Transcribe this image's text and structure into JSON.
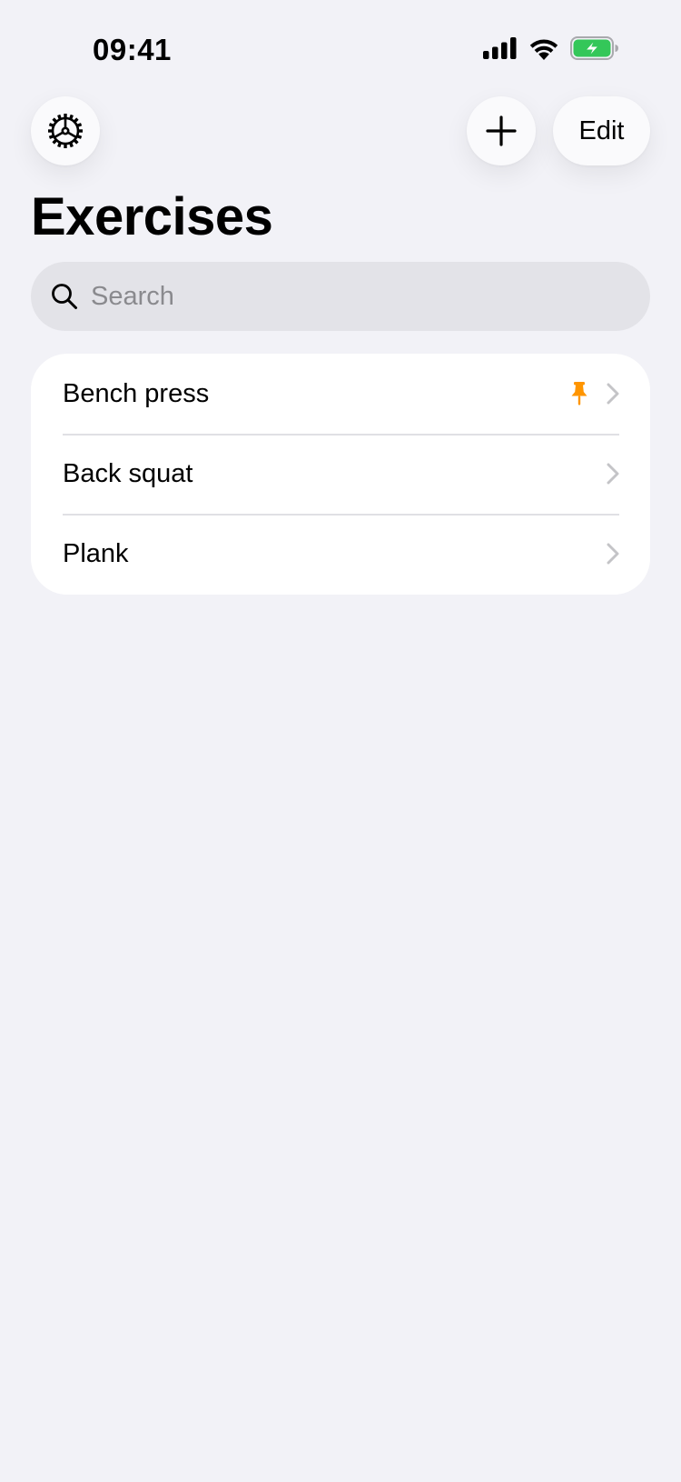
{
  "status_bar": {
    "time": "09:41",
    "icons": [
      "cellular-signal-icon",
      "wifi-icon",
      "battery-charging-icon"
    ],
    "battery_color": "#34c759"
  },
  "toolbar": {
    "settings_icon": "gear-icon",
    "add_icon": "plus-icon",
    "edit_label": "Edit"
  },
  "page": {
    "title": "Exercises"
  },
  "search": {
    "placeholder": "Search",
    "value": ""
  },
  "exercises": [
    {
      "label": "Bench press",
      "pinned": true
    },
    {
      "label": "Back squat",
      "pinned": false
    },
    {
      "label": "Plank",
      "pinned": false
    }
  ],
  "colors": {
    "background": "#f2f2f7",
    "pin": "#ff9500",
    "chevron": "#c4c4c7"
  }
}
